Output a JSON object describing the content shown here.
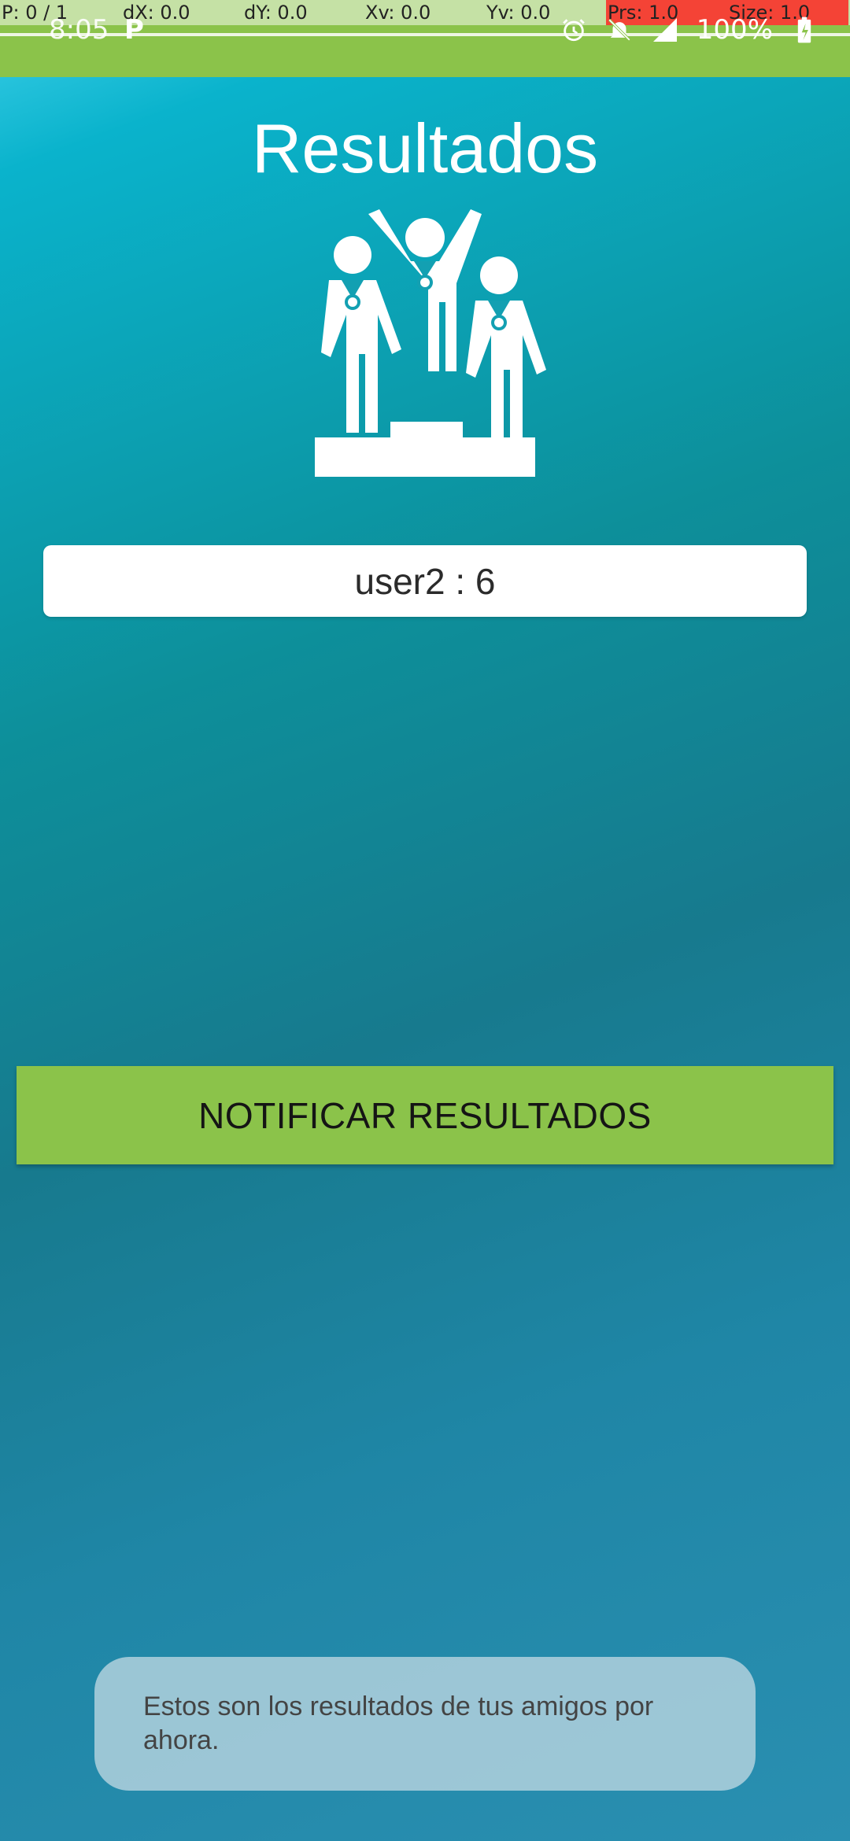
{
  "debug_overlay": {
    "cells": [
      "P: 0 / 1",
      "dX: 0.0",
      "dY: 0.0",
      "Xv: 0.0",
      "Yv: 0.0",
      "Prs: 1.0",
      "Size: 1.0"
    ]
  },
  "status_bar": {
    "time": "8:05",
    "battery": "100%",
    "colors": {
      "background": "#8bc34a"
    }
  },
  "screen": {
    "title": "Resultados",
    "result_entry": "user2 : 6",
    "notify_button_label": "NOTIFICAR RESULTADOS",
    "toast_message": "Estos son los resultados de tus amigos por ahora."
  },
  "theme": {
    "accent": "#8bc34a",
    "gradient_top": "#0ab3cc",
    "gradient_bottom": "#2a8fb1"
  },
  "icons": {
    "podium": "winners-podium-icon",
    "alarm": "alarm-icon",
    "notifications_off": "bell-off-icon",
    "signal": "signal-icon",
    "battery": "battery-charging-icon",
    "app": "p-app-icon"
  }
}
